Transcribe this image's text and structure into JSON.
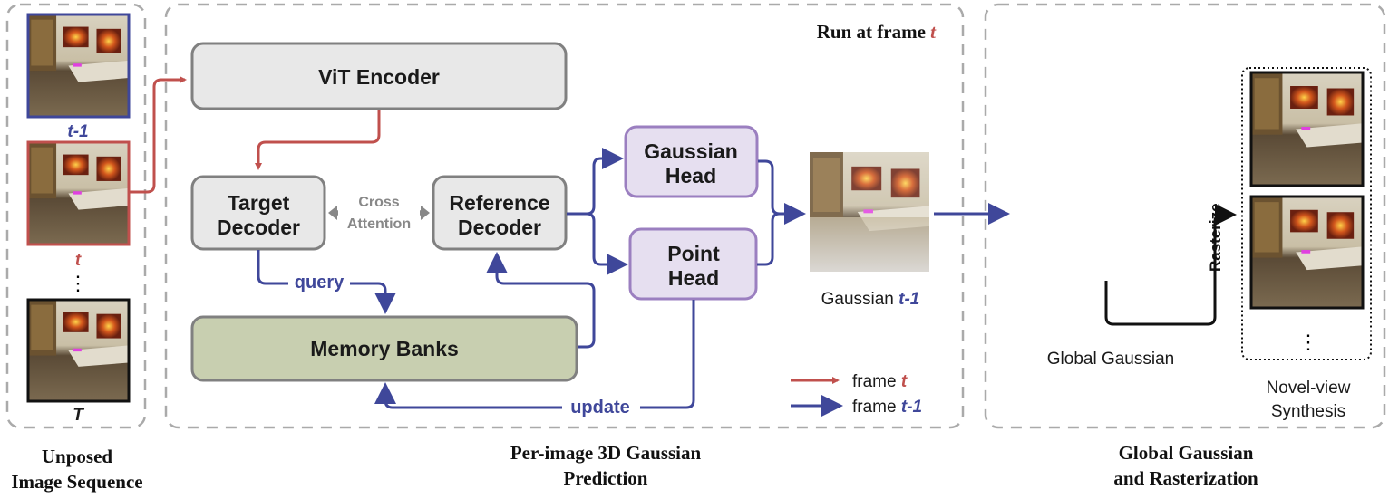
{
  "colors": {
    "frame_t": "#c0504d",
    "frame_t_minus_1": "#3f479a",
    "encoder_box": "#e8e8e8",
    "head_box": "#e6dff0",
    "memory_box": "#c8cfb0"
  },
  "panels": {
    "input": {
      "caption_line1": "Unposed",
      "caption_line2": "Image Sequence",
      "frames": [
        {
          "label": "t-1"
        },
        {
          "label": "t"
        },
        {
          "label": "T"
        }
      ],
      "ellipsis": "⋮"
    },
    "prediction": {
      "caption_line1": "Per-image 3D Gaussian",
      "caption_line2": "Prediction",
      "run_label": "Run at frame ",
      "run_var": "t",
      "vit_encoder": "ViT Encoder",
      "target_decoder_1": "Target",
      "target_decoder_2": "Decoder",
      "reference_decoder_1": "Reference",
      "reference_decoder_2": "Decoder",
      "cross_attention_1": "Cross",
      "cross_attention_2": "Attention",
      "gaussian_head_1": "Gaussian",
      "gaussian_head_2": "Head",
      "point_head_1": "Point",
      "point_head_2": "Head",
      "memory_banks": "Memory Banks",
      "query": "query",
      "update": "update",
      "gaussian_label": "Gaussian ",
      "gaussian_var": "t-1",
      "legend": [
        {
          "text": "frame ",
          "var": "t"
        },
        {
          "text": "frame ",
          "var": "t-1"
        }
      ]
    },
    "global": {
      "caption_line1": "Global Gaussian",
      "caption_line2": "and Rasterization",
      "global_gaussian": "Global Gaussian",
      "rasterize": "Rasterize",
      "novel_view_1": "Novel-view",
      "novel_view_2": "Synthesis",
      "ellipsis": "⋮"
    }
  }
}
